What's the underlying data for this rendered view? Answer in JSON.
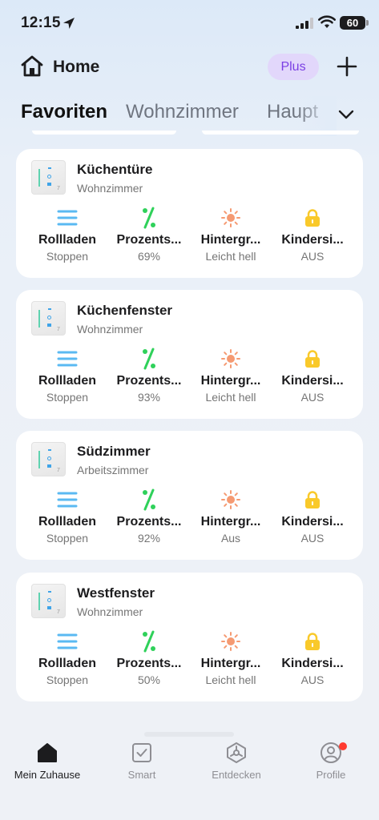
{
  "status_bar": {
    "time": "12:15",
    "battery": "60"
  },
  "header": {
    "title": "Home",
    "plus_label": "Plus"
  },
  "tabs": [
    {
      "label": "Favoriten",
      "active": true
    },
    {
      "label": "Wohnzimmer",
      "active": false
    },
    {
      "label": "Haupt",
      "active": false
    }
  ],
  "colors": {
    "rollladen_icon": "#5ab9f2",
    "percent_icon": "#2fd15a",
    "brightness_icon": "#f59a72",
    "lock_icon": "#f9c92a",
    "plus_badge_bg": "#e2d7fb",
    "plus_badge_text": "#7b3fe4",
    "notification": "#ff3b30"
  },
  "devices": [
    {
      "name": "Küchentüre",
      "room": "Wohnzimmer",
      "features": [
        {
          "icon": "rollladen-icon",
          "label": "Rollladen",
          "value": "Stoppen"
        },
        {
          "icon": "percent-icon",
          "label": "Prozents...",
          "value": "69%"
        },
        {
          "icon": "brightness-icon",
          "label": "Hintergr...",
          "value": "Leicht hell"
        },
        {
          "icon": "lock-icon",
          "label": "Kindersi...",
          "value": "AUS"
        }
      ]
    },
    {
      "name": "Küchenfenster",
      "room": "Wohnzimmer",
      "features": [
        {
          "icon": "rollladen-icon",
          "label": "Rollladen",
          "value": "Stoppen"
        },
        {
          "icon": "percent-icon",
          "label": "Prozents...",
          "value": "93%"
        },
        {
          "icon": "brightness-icon",
          "label": "Hintergr...",
          "value": "Leicht hell"
        },
        {
          "icon": "lock-icon",
          "label": "Kindersi...",
          "value": "AUS"
        }
      ]
    },
    {
      "name": "Südzimmer",
      "room": "Arbeitszimmer",
      "features": [
        {
          "icon": "rollladen-icon",
          "label": "Rollladen",
          "value": "Stoppen"
        },
        {
          "icon": "percent-icon",
          "label": "Prozents...",
          "value": "92%"
        },
        {
          "icon": "brightness-icon",
          "label": "Hintergr...",
          "value": "Aus"
        },
        {
          "icon": "lock-icon",
          "label": "Kindersi...",
          "value": "AUS"
        }
      ]
    },
    {
      "name": "Westfenster",
      "room": "Wohnzimmer",
      "features": [
        {
          "icon": "rollladen-icon",
          "label": "Rollladen",
          "value": "Stoppen"
        },
        {
          "icon": "percent-icon",
          "label": "Prozents...",
          "value": "50%"
        },
        {
          "icon": "brightness-icon",
          "label": "Hintergr...",
          "value": "Leicht hell"
        },
        {
          "icon": "lock-icon",
          "label": "Kindersi...",
          "value": "AUS"
        }
      ]
    }
  ],
  "bottom_nav": [
    {
      "icon": "home-icon",
      "label": "Mein Zuhause",
      "active": true
    },
    {
      "icon": "smart-checkbox-icon",
      "label": "Smart",
      "active": false
    },
    {
      "icon": "discover-icon",
      "label": "Entdecken",
      "active": false
    },
    {
      "icon": "profile-icon",
      "label": "Profile",
      "active": false,
      "notification": true
    }
  ]
}
